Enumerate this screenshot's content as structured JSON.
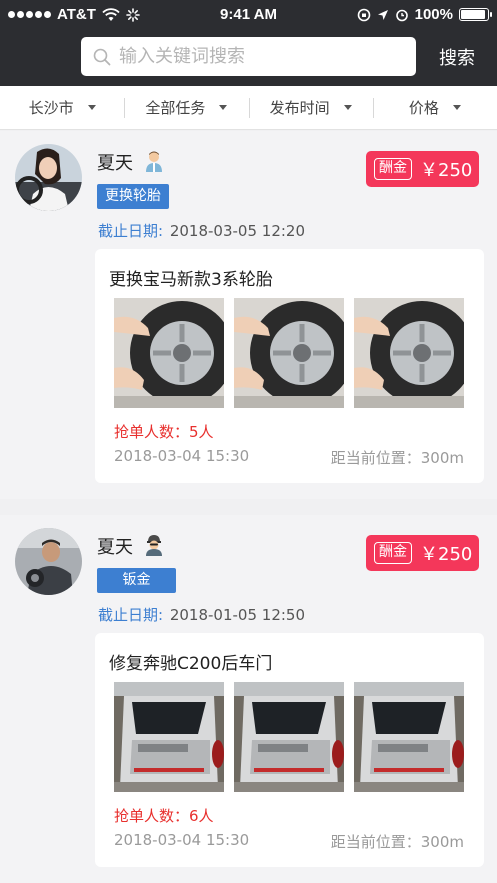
{
  "status_bar": {
    "carrier": "AT&T",
    "time": "9:41 AM",
    "battery": "100%"
  },
  "search": {
    "placeholder": "输入关键词搜索",
    "value": "",
    "button_label": "搜索"
  },
  "filters": [
    {
      "label": "长沙市",
      "icon": "caret-down-icon"
    },
    {
      "label": "全部任务",
      "icon": "caret-down-icon"
    },
    {
      "label": "发布时间",
      "icon": "caret-down-icon"
    },
    {
      "label": "价格",
      "icon": "caret-down-icon"
    }
  ],
  "posts": [
    {
      "name": "夏天",
      "role_icon": "mechanic-person-icon",
      "category": "更换轮胎",
      "deadline_label": "截止日期:",
      "deadline": "2018-03-05 12:20",
      "reward_badge": "酬金",
      "reward": "￥250",
      "task_title": "更换宝马新款3系轮胎",
      "photo_type": "tire",
      "grab_count": "抢单人数：5人",
      "posted_time": "2018-03-04 15:30",
      "distance": "距当前位置：300m"
    },
    {
      "name": "夏天",
      "role_icon": "worker-person-icon",
      "category": "钣金",
      "deadline_label": "截止日期:",
      "deadline": "2018-01-05 12:50",
      "reward_badge": "酬金",
      "reward": "￥250",
      "task_title": "修复奔驰C200后车门",
      "photo_type": "door",
      "grab_count": "抢单人数：6人",
      "posted_time": "2018-03-04 15:30",
      "distance": "距当前位置：300m"
    }
  ],
  "colors": {
    "header_bg": "#2c2d31",
    "tag_blue": "#3d7fd1",
    "reward_red": "#f4375a",
    "grab_red": "#e8302e"
  }
}
